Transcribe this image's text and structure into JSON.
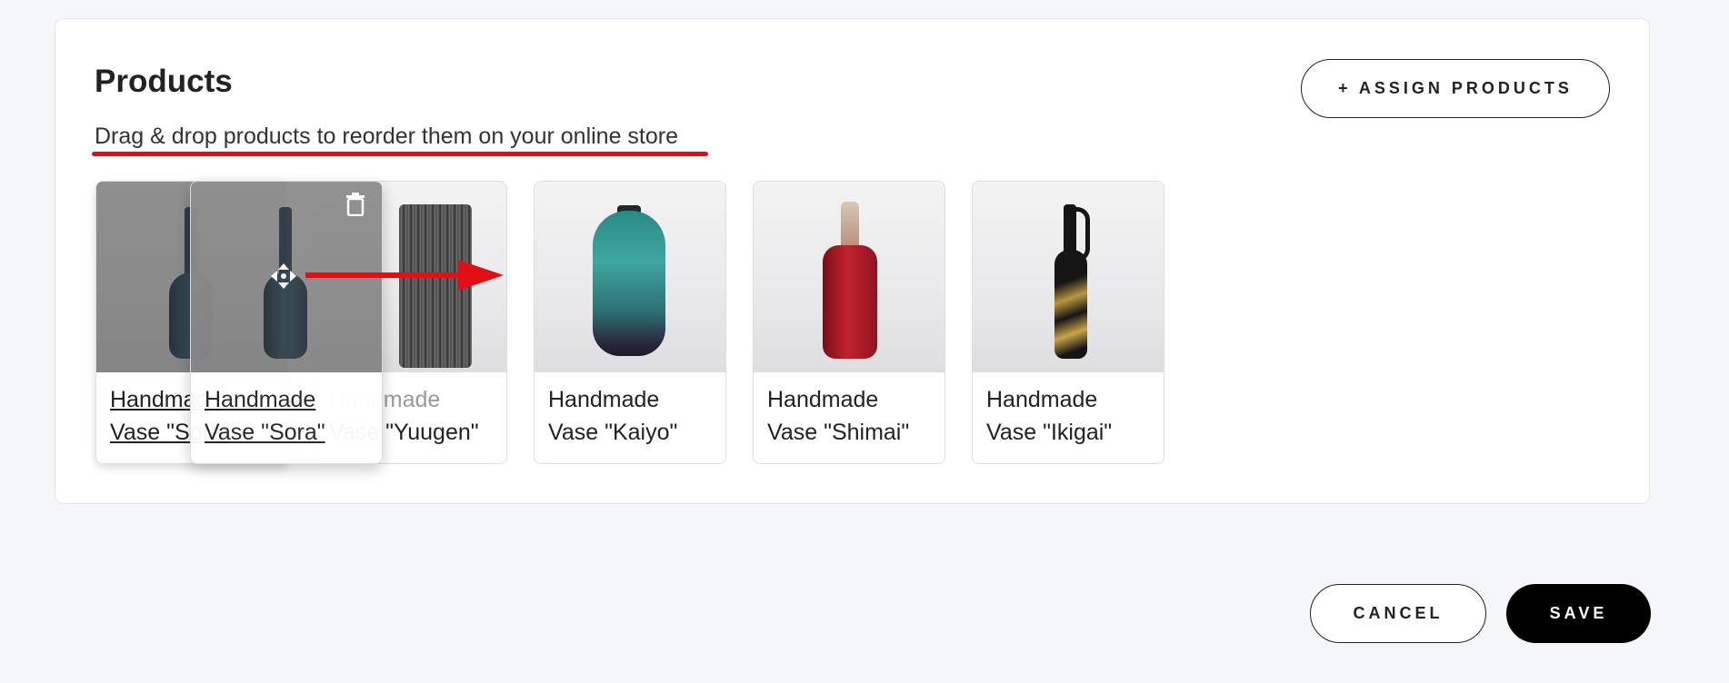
{
  "products_section": {
    "title": "Products",
    "subtitle": "Drag & drop products to reorder them on your online store",
    "assign_button": "+ ASSIGN PRODUCTS"
  },
  "products": [
    {
      "name_line1": "Handmade",
      "name_line2": "Vase \"Sora\""
    },
    {
      "name_line1": "Handmade",
      "name_line2": "Vase \"Yuugen\""
    },
    {
      "name_line1": "Handmade",
      "name_line2": "Vase \"Kaiyo\""
    },
    {
      "name_line1": "Handmade",
      "name_line2": "Vase \"Shimai\""
    },
    {
      "name_line1": "Handmade",
      "name_line2": "Vase \"Ikigai\""
    }
  ],
  "dragging_product": {
    "name_line1": "Handmade",
    "name_line2": "Vase \"Sora\""
  },
  "icons": {
    "drag": "drag-move-icon",
    "delete": "trash-icon"
  },
  "annotation_color": "#e10f14",
  "footer": {
    "cancel_button": "CANCEL",
    "save_button": "SAVE"
  }
}
